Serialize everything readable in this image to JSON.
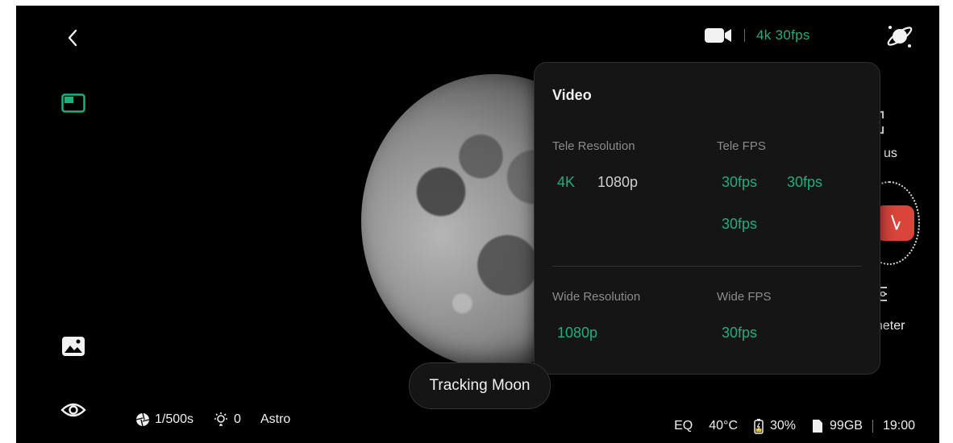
{
  "top_bar": {
    "video_settings": "4k 30fps"
  },
  "popup": {
    "title": "Video",
    "tele_resolution": {
      "label": "Tele Resolution",
      "options": [
        "4K",
        "1080p"
      ],
      "selected": "4K"
    },
    "tele_fps": {
      "label": "Tele FPS",
      "options": [
        "30fps",
        "30fps",
        "30fps"
      ]
    },
    "wide_resolution": {
      "label": "Wide Resolution",
      "options": [
        "1080p"
      ]
    },
    "wide_fps": {
      "label": "Wide FPS",
      "options": [
        "30fps"
      ]
    }
  },
  "right_panel": {
    "focus_label_partial": "us",
    "parameter_label_partial": "neter"
  },
  "tracking": {
    "label": "Tracking Moon"
  },
  "status_left": {
    "shutter": "1/500s",
    "exposure": "0",
    "mode": "Astro"
  },
  "status_right": {
    "mount": "EQ",
    "temperature": "40°C",
    "battery": "30%",
    "storage": "99GB",
    "time": "19:00"
  },
  "colors": {
    "accent": "#1fae7e",
    "shutter_red": "#d9453b",
    "background": "#000000",
    "panel": "#151515"
  }
}
